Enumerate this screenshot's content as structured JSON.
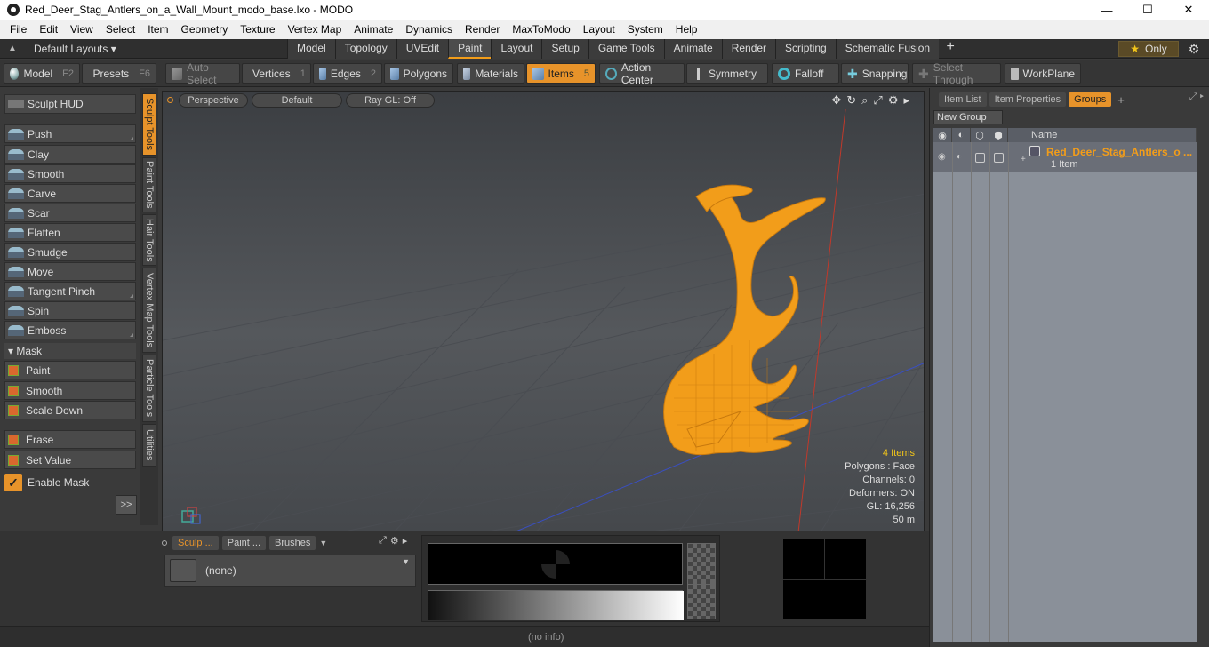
{
  "window": {
    "title": "Red_Deer_Stag_Antlers_on_a_Wall_Mount_modo_base.lxo - MODO",
    "minimize": "—",
    "maximize": "☐",
    "close": "✕"
  },
  "menu": [
    "File",
    "Edit",
    "View",
    "Select",
    "Item",
    "Geometry",
    "Texture",
    "Vertex Map",
    "Animate",
    "Dynamics",
    "Render",
    "MaxToModo",
    "Layout",
    "System",
    "Help"
  ],
  "layoutbar": {
    "dropdown": "Default Layouts ▾",
    "tabs": [
      "Model",
      "Topology",
      "UVEdit",
      "Paint",
      "Layout",
      "Setup",
      "Game Tools",
      "Animate",
      "Render",
      "Scripting",
      "Schematic Fusion"
    ],
    "active_tab": "Paint",
    "only_label": "Only"
  },
  "toolbar": {
    "model": "Model",
    "model_key": "F2",
    "presets": "Presets",
    "presets_key": "F6",
    "auto_select": "Auto Select",
    "vertices": "Vertices",
    "vertices_key": "1",
    "edges": "Edges",
    "edges_key": "2",
    "polygons": "Polygons",
    "materials": "Materials",
    "items": "Items",
    "items_key": "5",
    "action_center": "Action Center",
    "symmetry": "Symmetry",
    "falloff": "Falloff",
    "snapping": "Snapping",
    "select_through": "Select Through",
    "workplane": "WorkPlane"
  },
  "left_panel": {
    "sculpt_hud": "Sculpt HUD",
    "tools": [
      "Push",
      "Clay",
      "Smooth",
      "Carve",
      "Scar",
      "Flatten",
      "Smudge",
      "Move",
      "Tangent Pinch",
      "Spin",
      "Emboss"
    ],
    "mask_header": "Mask",
    "mask_tools": [
      "Paint",
      "Smooth",
      "Scale Down"
    ],
    "extra_tools": [
      "Erase",
      "Set Value"
    ],
    "enable_mask": "Enable Mask",
    "more": ">>"
  },
  "vertical_tabs": [
    "Sculpt Tools",
    "Paint Tools",
    "Hair Tools",
    "Vertex Map Tools",
    "Particle Tools",
    "Utilities"
  ],
  "viewport": {
    "view": "Perspective",
    "shading": "Default",
    "raygl": "Ray GL: Off",
    "info": {
      "items": "4 Items",
      "polygons": "Polygons : Face",
      "channels": "Channels: 0",
      "deformers": "Deformers: ON",
      "gl": "GL: 16,256",
      "scale": "50 m"
    },
    "model_color": "#f29d1a"
  },
  "bottom": {
    "tabs": [
      "Sculp ...",
      "Paint ...",
      "Brushes"
    ],
    "brush": "(none)",
    "status": "(no info)"
  },
  "right_panel": {
    "tabs": [
      "Item List",
      "Item Properties",
      "Groups"
    ],
    "active_tab": "Groups",
    "new_group": "New Group",
    "col_name": "Name",
    "item_name": "Red_Deer_Stag_Antlers_o ...",
    "item_count": "1 Item"
  }
}
